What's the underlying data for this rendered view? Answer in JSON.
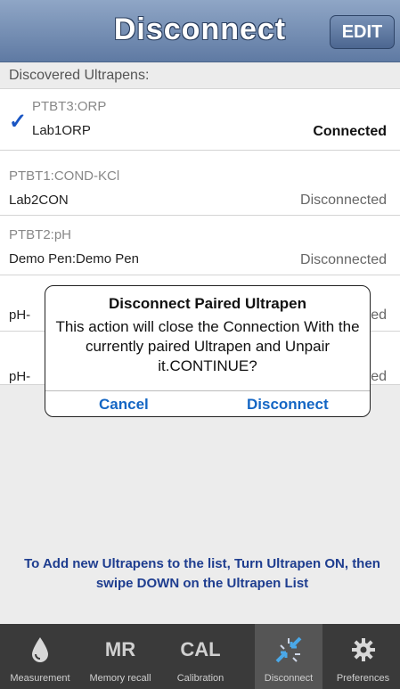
{
  "header": {
    "title": "Disconnect",
    "edit_label": "EDIT"
  },
  "list_header": "Discovered Ultrapens:",
  "devices": [
    {
      "id": "PTBT3:ORP",
      "name": "Lab1ORP",
      "status": "Connected",
      "selected": true
    },
    {
      "id": "PTBT1:COND-KCl",
      "name": "Lab2CON",
      "status": "Disconnected"
    },
    {
      "id": "PTBT2:pH",
      "name": "Demo Pen:Demo Pen",
      "status": "Disconnected"
    },
    {
      "id": "",
      "name": "pH-",
      "status": "ed"
    },
    {
      "id": "",
      "name": "pH-",
      "status": "ed"
    }
  ],
  "hint": "To Add new Ultrapens to the list, Turn Ultrapen ON, then swipe DOWN on the Ultrapen List",
  "dialog": {
    "title": "Disconnect Paired Ultrapen",
    "message": "This action will close the Connection With the currently paired Ultrapen and Unpair it.CONTINUE?",
    "cancel": "Cancel",
    "confirm": "Disconnect"
  },
  "tabs": [
    {
      "icon": "water-drop-icon",
      "label": "Measurement"
    },
    {
      "icon_text": "MR",
      "label": "Memory recall"
    },
    {
      "icon_text": "CAL",
      "label": "Calibration"
    },
    {
      "icon": "disconnect-icon",
      "label": "Disconnect",
      "active": true
    },
    {
      "icon": "gear-icon",
      "label": "Preferences"
    }
  ],
  "colors": {
    "header": "#6f88ae",
    "accent": "#1466c4",
    "hint": "#1e3d8f",
    "tabbar": "#3a3a3a"
  }
}
